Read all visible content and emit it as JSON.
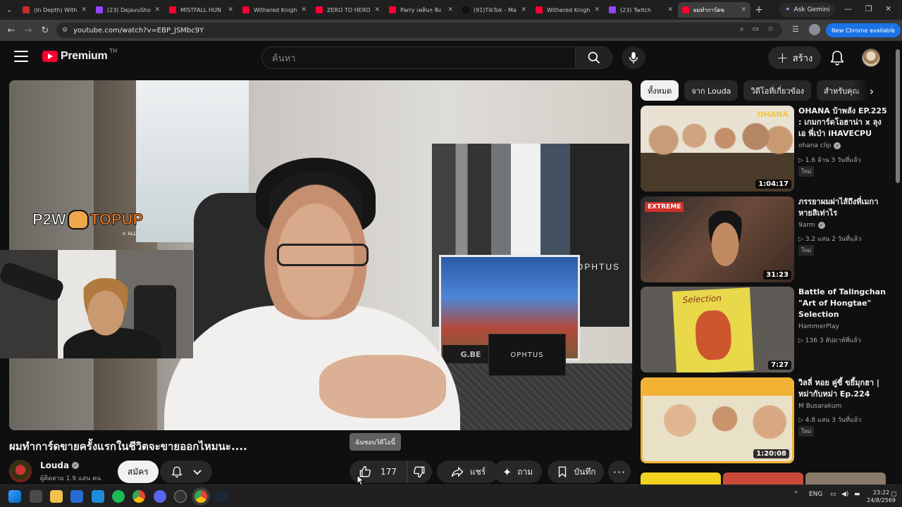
{
  "browser": {
    "tabs": [
      {
        "title": "(In Depth) With",
        "color": "#cc2a2a"
      },
      {
        "title": "(23) DejavuSho",
        "color": "#9146ff"
      },
      {
        "title": "MISTFALL HUN",
        "color": "#ff0033"
      },
      {
        "title": "Withered Knigh",
        "color": "#ff0033"
      },
      {
        "title": "ZERO TO HERO",
        "color": "#ff0033"
      },
      {
        "title": "Parry เพลินๆ ฟัง",
        "color": "#ff0033"
      },
      {
        "title": "(91)TikTok - Ma",
        "color": "#111111"
      },
      {
        "title": "Withered Knigh",
        "color": "#ff0033"
      },
      {
        "title": "(23) Twitch",
        "color": "#9146ff"
      },
      {
        "title": "ผมทำการ์ดข",
        "color": "#ff0033",
        "active": true
      }
    ],
    "ask_gemini": "Ask Gemini",
    "url": "youtube.com/watch?v=EBP_JSMbc9Y",
    "new_chrome": "New Chrome available"
  },
  "youtube": {
    "logo_word": "Premium",
    "country_code": "TH",
    "search_placeholder": "ค้นหา",
    "create_label": "สร้าง"
  },
  "video": {
    "overlay_logo_left": "P2W",
    "overlay_logo_right": "TOPUP",
    "overlay_sub": "× ALL",
    "wall_brand": "OPHTUS",
    "box_brand": "OPHTUS",
    "title": "ผมทำการ์ดขายครั้งแรกในชีวิตจะขายออกไหมนะ....",
    "channel": "Louda",
    "subscribers": "ผู้ติดตาม 1.9 แสน คน",
    "subscribe_label": "สมัคร",
    "tooltip": "ฉันชอบวิดีโอนี้",
    "likes": "177",
    "share_label": "แชร์",
    "ask_label": "ถาม",
    "save_label": "บันทึก"
  },
  "sidebar": {
    "chips": [
      "ทั้งหมด",
      "จาก Louda",
      "วิดีโอที่เกี่ยวข้อง",
      "สำหรับคุณ"
    ],
    "recommendations": [
      {
        "title": "OHANA บ้าพลัง EP.225 : เกมการ์ดโอฮาน่า x ลุงเอ พี่เป่า iHAVECPU",
        "channel": "ohana clip",
        "verified": true,
        "meta": "▷ 1.6 ล้าน  3 วันที่แล้ว",
        "badge": "ใหม่",
        "duration": "1:04:17"
      },
      {
        "title": "ภรรยาผมผ่าไส้ถึงที่เมกา หายสิเท่าไร",
        "channel": "9arm",
        "verified": true,
        "meta": "▷ 3.2 แสน  2 วันที่แล้ว",
        "badge": "ใหม่",
        "duration": "31:23"
      },
      {
        "title": "Battle of Talingchan \"Art of Hongtae\" Selection",
        "channel": "HammerPlay",
        "verified": false,
        "meta": "▷ 136  3 สัปดาห์ที่แล้ว",
        "badge": "",
        "duration": "7:27"
      },
      {
        "title": "วิลลี่ หอย คู่ซี้ ขยี้มุกฮา | หม่ากับหม่า Ep.224",
        "channel": "M Busarakum",
        "verified": false,
        "meta": "▷ 4.8 แสน  3 วันที่แล้ว",
        "badge": "ใหม่",
        "duration": "1:20:08"
      }
    ]
  },
  "taskbar": {
    "lang": "ENG",
    "time": "23:22",
    "date": "24/8/2569"
  }
}
